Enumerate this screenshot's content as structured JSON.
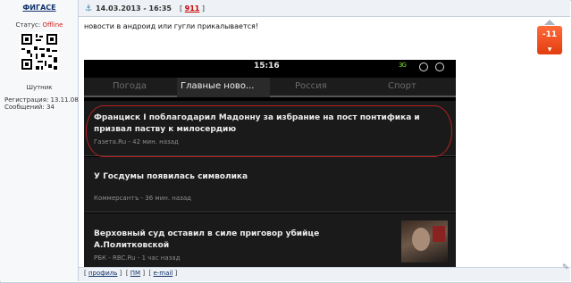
{
  "user": {
    "username": "ФИГАСЕ",
    "status_label": "Статус:",
    "status_value": "Offline",
    "rank": "Шутник",
    "registration_label": "Регистрация:",
    "registration_value": "13.11.08",
    "messages_label": "Сообщений:",
    "messages_value": "34"
  },
  "post": {
    "datetime": "14.03.2013 - 16:35",
    "number": "911",
    "message": "новости в андроид или гугли прикалывается!",
    "rating": "-11",
    "rating_down": "▼"
  },
  "phone": {
    "time": "15:16",
    "signal_text": "3G",
    "tabs": [
      "Погода",
      "Главные ново...",
      "Россия",
      "Спорт"
    ],
    "items": [
      {
        "title_line1": "Франциск I поблагодарил Мадонну за избрание на пост понтифика и",
        "title_line2": "призвал паству к милосердию",
        "source": "Газета.Ru - 42 мин. назад"
      },
      {
        "title_line1": "У Госдумы появилась символика",
        "title_line2": "",
        "source": "Коммерсантъ - 36 мин. назад"
      },
      {
        "title_line1": "Верховный суд оставил в силе приговор убийце",
        "title_line2": "А.Политковской",
        "source": "РБК - RBC.Ru - 1 час назад"
      }
    ]
  },
  "footer": {
    "profile": "профиль",
    "pm": "ПМ",
    "email": "e-mail"
  },
  "colors": {
    "rating_bg": "#e8431a",
    "offline": "#cc2222",
    "post_number": "#cc0000"
  }
}
